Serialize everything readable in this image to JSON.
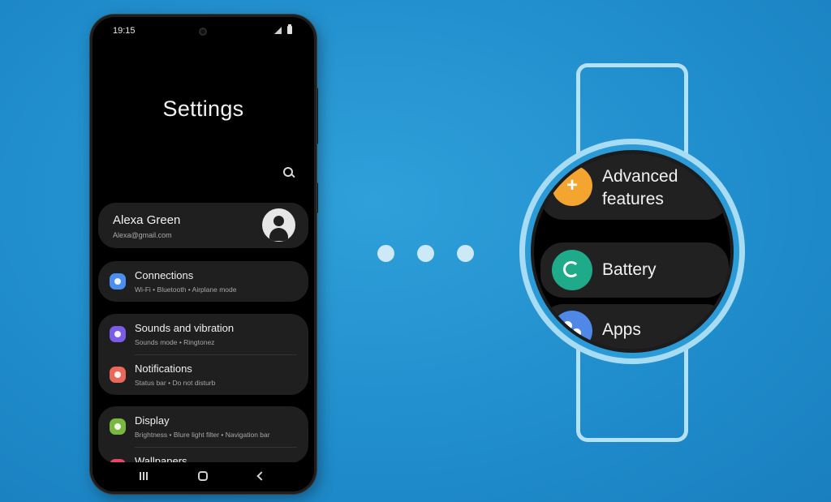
{
  "phone": {
    "status": {
      "time": "19:15",
      "signal_icon": "signal-icon",
      "battery_icon": "battery-icon"
    },
    "title": "Settings",
    "search_icon": "search-icon",
    "profile": {
      "name": "Alexa Green",
      "email": "Alexa@gmail.com",
      "avatar_icon": "person-icon"
    },
    "items": [
      {
        "title": "Connections",
        "subtitle": "Wi-Fi  •  Bluetooth  •  Airplane mode",
        "icon": "wifi-icon",
        "color": "#4a8ff0"
      },
      {
        "title": "Sounds and vibration",
        "subtitle": "Sounds mode  •  Ringtonez",
        "icon": "volume-icon",
        "color": "#7b5ce6"
      },
      {
        "title": "Notifications",
        "subtitle": "Status bar  •  Do not disturb",
        "icon": "notification-icon",
        "color": "#e8685a"
      },
      {
        "title": "Display",
        "subtitle": "Brightness  •  Blure light filter  •  Navigation bar",
        "icon": "brightness-icon",
        "color": "#7ab83d"
      },
      {
        "title": "Wallpapers",
        "subtitle": "",
        "icon": "wallpaper-icon",
        "color": "#e8446c"
      }
    ],
    "nav": {
      "recents_icon": "recents-icon",
      "home_icon": "home-icon",
      "back_icon": "back-icon"
    }
  },
  "watch": {
    "items": [
      {
        "label": "Advanced features",
        "icon": "advanced-features-icon",
        "color": "#f3a530"
      },
      {
        "label": "Battery",
        "icon": "battery-icon",
        "color": "#1faa8a"
      },
      {
        "label": "Apps",
        "icon": "apps-icon",
        "color": "#4f88e6"
      }
    ]
  },
  "colors": {
    "background": "#2196d3",
    "watch_bezel": "#a8dcf5",
    "dots": "#cde9f8"
  }
}
